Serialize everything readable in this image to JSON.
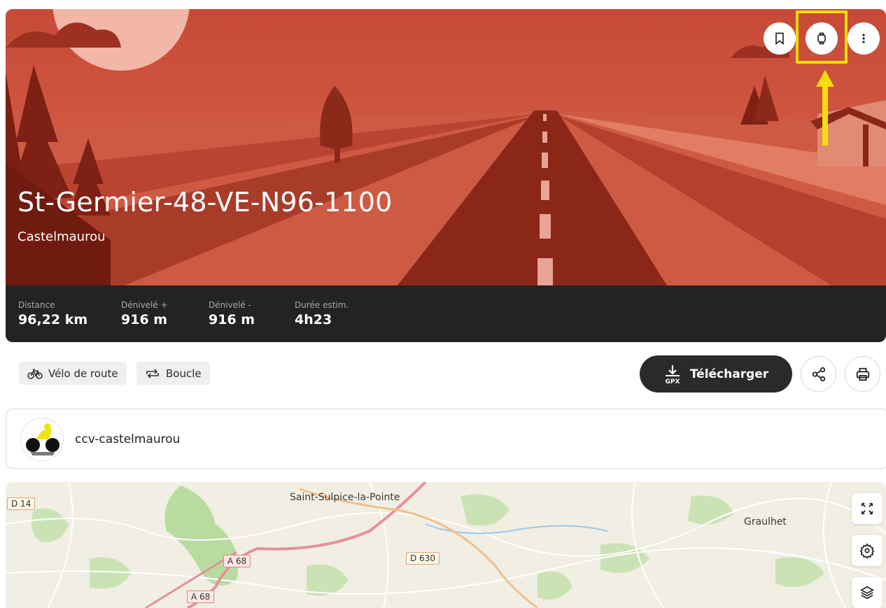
{
  "route": {
    "title": "St-Germier-48-VE-N96-1100",
    "location": "Castelmaurou"
  },
  "stats": [
    {
      "label": "Distance",
      "value": "96,22 km"
    },
    {
      "label": "Dénivelé +",
      "value": "916 m"
    },
    {
      "label": "Dénivelé -",
      "value": "916 m"
    },
    {
      "label": "Durée estim.",
      "value": "4h23"
    }
  ],
  "tags": {
    "bike": "Vélo de route",
    "loop": "Boucle"
  },
  "actions": {
    "download": "Télécharger",
    "download_format": "GPX"
  },
  "author": {
    "name": "ccv-castelmaurou"
  },
  "map": {
    "places": {
      "saint_sulpice": "Saint-Sulpice-la-Pointe",
      "graulhet": "Graulhet"
    },
    "roads": {
      "d14": "D 14",
      "a68_1": "A 68",
      "a68_2": "A 68",
      "d630": "D 630"
    }
  },
  "colors": {
    "hero_red": "#c9503b",
    "dark_bar": "#232323",
    "highlight_yellow": "#f5dd0a"
  },
  "icons": [
    "bookmark-icon",
    "watch-icon",
    "more-vertical-icon",
    "bike-icon",
    "loop-icon",
    "download-gpx-icon",
    "share-icon",
    "print-icon",
    "expand-icon",
    "settings-icon",
    "layers-icon"
  ]
}
